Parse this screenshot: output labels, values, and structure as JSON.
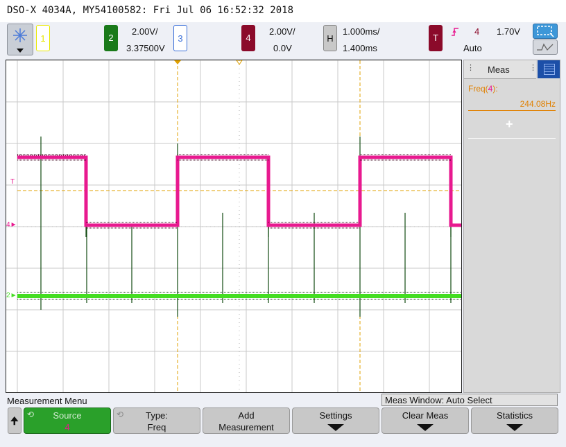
{
  "title": "DSO-X 4034A, MY54100582: Fri Jul 06 16:52:32 2018",
  "channels": {
    "ch1": {
      "label": "1",
      "color": "#e8e800"
    },
    "ch2": {
      "label": "2",
      "color": "#1a7a1a",
      "scale": "2.00V/",
      "offset": "3.37500V"
    },
    "ch3": {
      "label": "3",
      "color": "#3a6fd8"
    },
    "ch4": {
      "label": "4",
      "color": "#8b0a2a",
      "scale": "2.00V/",
      "offset": "0.0V"
    }
  },
  "horizontal": {
    "label": "H",
    "timebase": "1.000ms/",
    "delay": "1.400ms"
  },
  "trigger": {
    "label": "T",
    "slope_icon": "rising-edge-icon",
    "source": "4",
    "level": "1.70V",
    "mode": "Auto"
  },
  "markers": {
    "trigger": "T",
    "ch4": "4",
    "ch2": "2"
  },
  "measurements": {
    "tab_label": "Meas",
    "items": [
      {
        "name": "Freq(",
        "source": "4",
        "suffix": "):",
        "value": "244.08Hz"
      }
    ],
    "add_icon": "+"
  },
  "menu": {
    "title": "Measurement Menu",
    "window_status": "Meas Window: Auto Select",
    "softkeys": [
      {
        "label": "Source",
        "value": "4",
        "active": true
      },
      {
        "label": "Type:",
        "value": "Freq"
      },
      {
        "label": "Add",
        "value": "Measurement"
      },
      {
        "label": "Settings",
        "value": ""
      },
      {
        "label": "Clear Meas",
        "value": ""
      },
      {
        "label": "Statistics",
        "value": ""
      }
    ]
  },
  "colors": {
    "ch4_trace": "#e8198f",
    "ch2_trace": "#44dd22",
    "cursor": "#e0a000",
    "background": "#eef0f6"
  }
}
